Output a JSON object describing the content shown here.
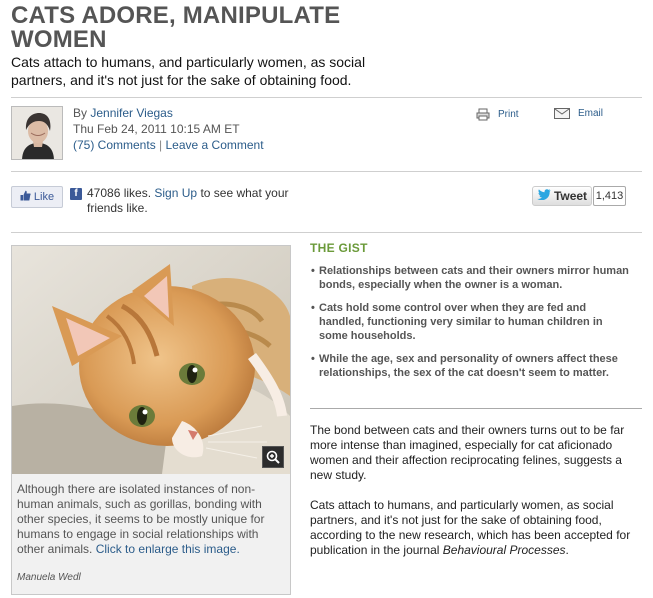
{
  "article": {
    "headline": "CATS ADORE, MANIPULATE WOMEN",
    "dek": "Cats attach to humans, and particularly women, as social partners, and it's not just for the sake of obtaining food."
  },
  "byline": {
    "by": "By",
    "author": "Jennifer Viegas",
    "date": "Thu Feb 24, 2011 10:15 AM ET",
    "comments": "(75) Comments",
    "separator": "|",
    "leave_comment": "Leave a Comment"
  },
  "tools": {
    "print": "Print",
    "email": "Email"
  },
  "social": {
    "like_label": "Like",
    "fb_glyph": "f",
    "likes_count": "47086 likes.",
    "signup": "Sign Up",
    "signup_rest": "to see what your friends like.",
    "tweet_label": "Tweet",
    "tweet_count": "1,413"
  },
  "figure": {
    "caption": "Although there are isolated instances of non-human animals, such as gorillas, bonding with other species, it seems to be mostly unique for humans to engage in social relationships with other animals.",
    "enlarge": "Click to enlarge this image.",
    "credit": "Manuela Wedl"
  },
  "gist": {
    "title": "THE GIST",
    "items": [
      "Relationships between cats and their owners mirror human bonds, especially when the owner is a woman.",
      "Cats hold some control over when they are fed and handled, functioning very similar to human children in some households.",
      "While the age, sex and personality of owners affect these relationships, the sex of the cat doesn't seem to matter."
    ]
  },
  "body": {
    "p1": "The bond between cats and their owners turns out to be far more intense than imagined, especially for cat aficionado women and their affection reciprocating felines, suggests a new study.",
    "p2_a": "Cats attach to humans, and particularly women, as social partners, and it's not just for the sake of obtaining food, according to the new research, which has been accepted for publication in the journal",
    "p2_journal": "Behavioural Processes",
    "p2_end": "."
  },
  "colors": {
    "headline": "#555555",
    "link": "#2b5c8a",
    "gist_title": "#6b9a3a",
    "facebook": "#3b5998",
    "twitter": "#2ba6e1"
  },
  "icons": [
    "print-icon",
    "email-icon",
    "like-thumb-icon",
    "facebook-icon",
    "twitter-bird-icon",
    "zoom-icon"
  ]
}
